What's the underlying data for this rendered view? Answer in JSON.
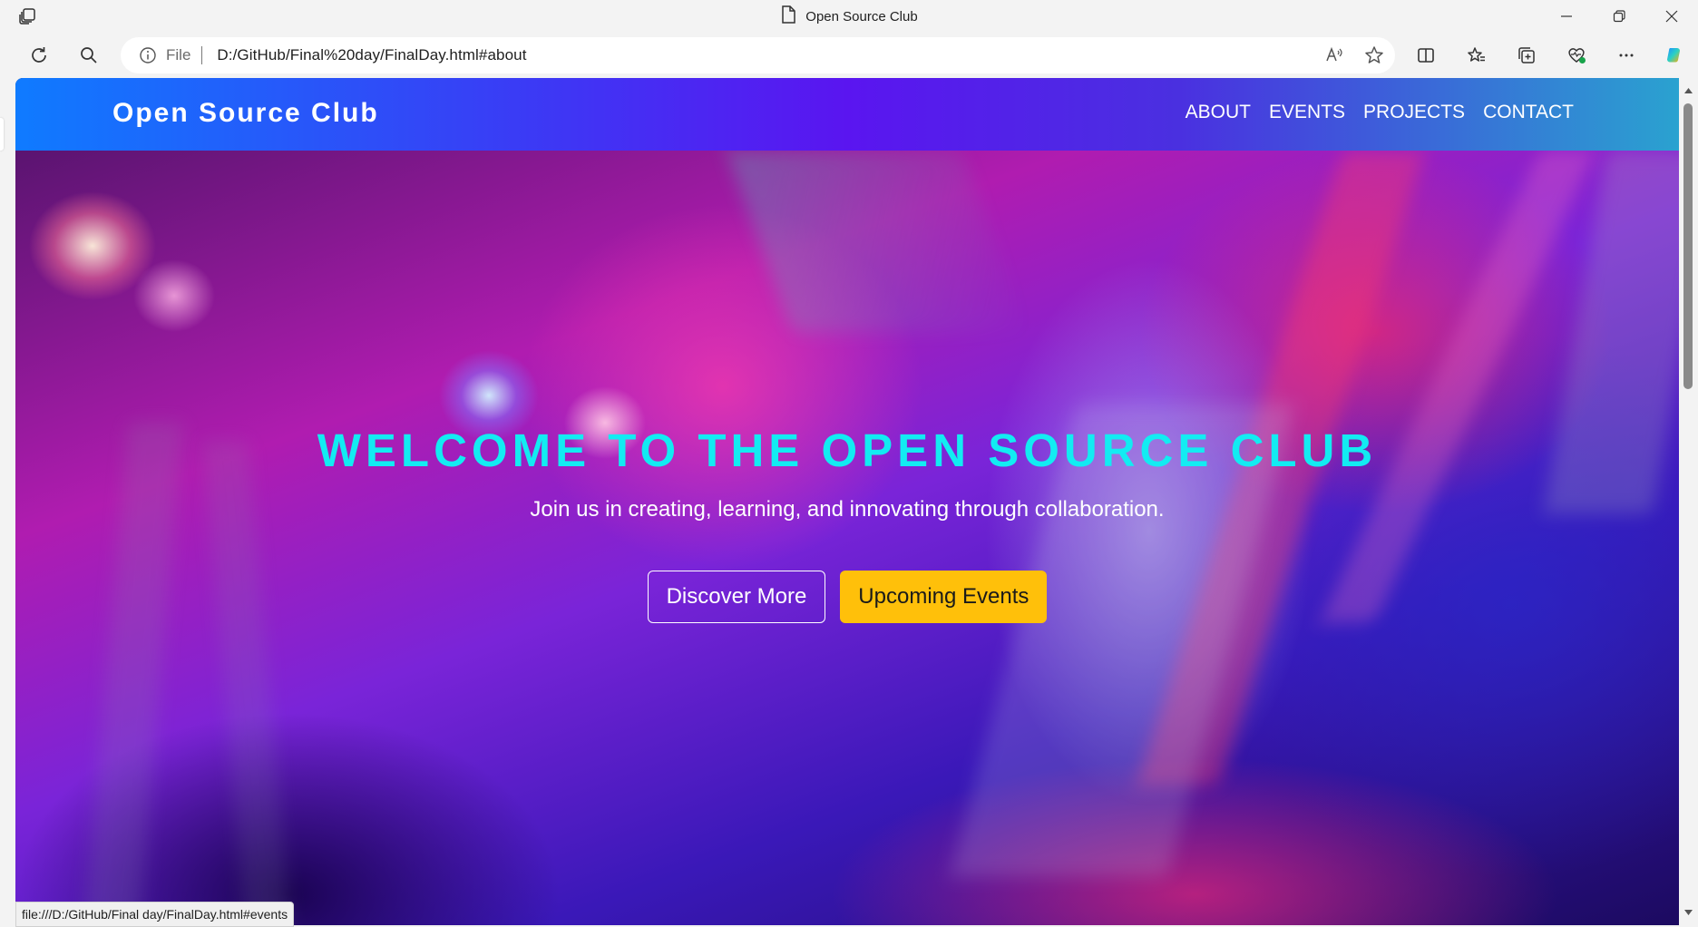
{
  "browser": {
    "tab_title": "Open Source Club",
    "address": {
      "scheme_label": "File",
      "url": "D:/GitHub/Final%20day/FinalDay.html#about"
    },
    "status_url": "file:///D:/GitHub/Final day/FinalDay.html#events",
    "icons": {
      "tab_actions": "tab-actions-icon",
      "page": "page-icon",
      "minimize": "minimize-icon",
      "restore": "restore-icon",
      "close": "close-icon",
      "refresh": "refresh-icon",
      "search": "search-icon",
      "info": "info-icon",
      "read_aloud": "read-aloud-icon",
      "favorite": "star-icon",
      "split": "split-screen-icon",
      "favorites": "favorites-icon",
      "collections": "collections-icon",
      "browser_essentials": "heart-pulse-icon",
      "more": "more-icon",
      "copilot": "copilot-icon"
    }
  },
  "site": {
    "brand": "Open Source Club",
    "nav": [
      {
        "label": "ABOUT"
      },
      {
        "label": "EVENTS"
      },
      {
        "label": "PROJECTS"
      },
      {
        "label": "CONTACT"
      }
    ],
    "hero": {
      "title": "WELCOME TO THE OPEN SOURCE CLUB",
      "subtitle": "Join us in creating, learning, and innovating through collaboration.",
      "primary_button": "Discover More",
      "secondary_button": "Upcoming Events"
    }
  },
  "colors": {
    "nav_gradient_start": "#0f7bff",
    "nav_gradient_mid": "#5a15f0",
    "nav_gradient_end": "#2aa2d0",
    "hero_title": "#12ecf2",
    "button_yellow": "#ffc00a"
  }
}
